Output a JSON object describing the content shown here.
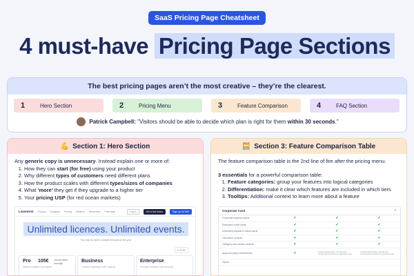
{
  "badge": "SaaS Pricing Page Cheatsheet",
  "headline": {
    "prefix": "4 must-have",
    "highlight": "Pricing Page Sections"
  },
  "intro": {
    "title": "The best pricing pages aren’t the most creative – they’re the clearest.",
    "sections": [
      {
        "num": "1",
        "label": "Hero Section",
        "color": "#fbdcdc"
      },
      {
        "num": "2",
        "label": "Pricing Menu",
        "color": "#d6f1d6"
      },
      {
        "num": "3",
        "label": "Feature Comparison",
        "color": "#fbe7cf"
      },
      {
        "num": "4",
        "label": "FAQ Section",
        "color": "#e9ddfb"
      }
    ],
    "quote_author": "Patrick Campbell:",
    "quote_text": "\"Visitors should be able to decide which plan is right for them",
    "quote_bold": "within 30 seconds",
    "quote_end": ".\""
  },
  "hero": {
    "icon": "flexed-biceps-icon",
    "title": "Section 1: Hero Section",
    "intro_bold": "generic copy is unnecessary",
    "intro_pre": "Any ",
    "intro_post": ". Instead explain one or more of:",
    "items": [
      {
        "pre": "How they can ",
        "bold": "start (for free)",
        "post": " using your product"
      },
      {
        "pre": "Why different ",
        "bold": "types of customers",
        "post": " need different plans"
      },
      {
        "pre": "How the product scales with different ",
        "bold": "types/sizes of companies",
        "post": ""
      },
      {
        "pre": "What ",
        "bold": "'more'",
        "post": " they get if they upgrade to a higher tier"
      },
      {
        "pre": "Your ",
        "bold": "pricing USP",
        "post": " (for red ocean markets)"
      }
    ],
    "mock": {
      "logo": "Livestorm",
      "nav": [
        "Product",
        "Solutions",
        "Pricing",
        "Platform",
        "Resources",
        "Free tools"
      ],
      "login": "Log in",
      "demo": "Get a live demo",
      "signup": "Sign up for free",
      "hero": "Unlimited licences. Unlimited events.",
      "sub": "Pay only for active contacts throughout the year",
      "currency": "€ EUR",
      "plans": [
        {
          "name": "Pro",
          "price": "105€",
          "unit": "/month billed annually",
          "desc": "Webinar platform for teams"
        },
        {
          "name": "Business",
          "price": "",
          "unit": "",
          "desc": "Custom branding & API support"
        },
        {
          "name": "Enterprise",
          "price": "",
          "unit": "",
          "desc": "Premium features with security"
        }
      ]
    }
  },
  "comparison": {
    "icon": "abacus-icon",
    "title": "Section 3: Feature Comparison Table",
    "lead": "The feature comparison table is the 2nd line of fire after the pricing menu.",
    "essentials_bold": "3 essentials",
    "essentials_post": " for a powerful comparison table:",
    "items": [
      {
        "bold": "Feature categories:",
        "post": " group your features into logical categories"
      },
      {
        "bold": "Differentiation:",
        "post": " make it clear which features are included in which tiers"
      },
      {
        "bold": "Tooltips:",
        "post": " Additional context to learn more about a feature"
      }
    ],
    "mock": {
      "title": "Corporate Card",
      "rows": [
        "Corporate expense cards",
        "Employee credit cards",
        "Unlimited physical & virtual cards",
        "Card-level controls",
        "Category and vendor controls",
        "Approval policy enforcement",
        "Travel"
      ],
      "note": "Customizable limits, controls and reimbursement flows at a granular level"
    }
  }
}
